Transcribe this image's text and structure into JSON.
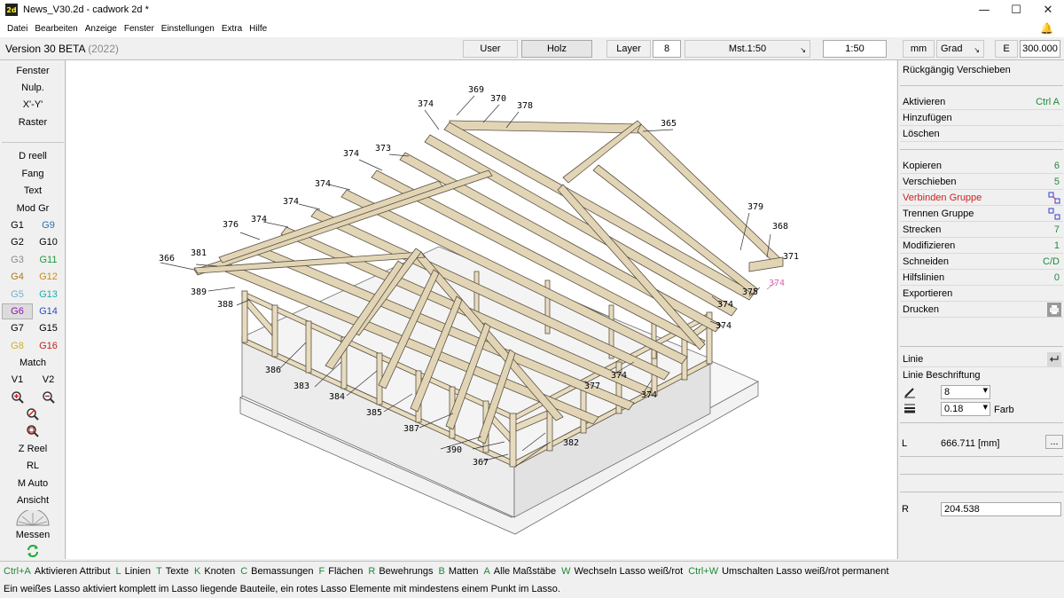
{
  "window": {
    "title": "News_V30.2d - cadwork 2d  *",
    "icon_text": "2d",
    "minimize": "—",
    "maximize": "☐",
    "close": "✕"
  },
  "menu": [
    "Datei",
    "Bearbeiten",
    "Anzeige",
    "Fenster",
    "Einstellungen",
    "Extra",
    "Hilfe"
  ],
  "toolbar": {
    "version": "Version 30 BETA",
    "year": "(2022)",
    "user": "User",
    "holz": "Holz",
    "layer": "Layer",
    "layer_value": "8",
    "scale": "Mst.1:50",
    "scale_value": "1:50",
    "unit": "mm",
    "angle": "Grad",
    "e_label": "E",
    "e_value": "300.000",
    "corner_glyph": "↘"
  },
  "left_panel": {
    "fenster": "Fenster",
    "nulp": "Nulp.",
    "xy": "X'-Y'",
    "raster": "Raster",
    "dreell": "D reell",
    "fang": "Fang",
    "text": "Text",
    "modgr": "Mod Gr",
    "groups": [
      {
        "l": "G1",
        "lc": "#000000",
        "r": "G9",
        "rc": "#2b6fb6"
      },
      {
        "l": "G2",
        "lc": "#000000",
        "r": "G10",
        "rc": "#000000"
      },
      {
        "l": "G3",
        "lc": "#8a8a8a",
        "r": "G11",
        "rc": "#1d9a3a"
      },
      {
        "l": "G4",
        "lc": "#b07a10",
        "r": "G12",
        "rc": "#d08a10"
      },
      {
        "l": "G5",
        "lc": "#70b0d0",
        "r": "G13",
        "rc": "#18b0b0"
      },
      {
        "l": "G6",
        "lc": "#8a1ab0",
        "r": "G14",
        "rc": "#2b4fb6"
      },
      {
        "l": "G7",
        "lc": "#000000",
        "r": "G15",
        "rc": "#000000"
      },
      {
        "l": "G8",
        "lc": "#d0b020",
        "r": "G16",
        "rc": "#c02020"
      }
    ],
    "match": "Match",
    "v1": "V1",
    "v2": "V2",
    "zreel": "Z Reel",
    "rl": "RL",
    "mauto": "M Auto",
    "ansicht": "Ansicht",
    "messen": "Messen"
  },
  "right_panel": {
    "undo": "Rückgängig Verschieben",
    "items": [
      {
        "label": "Aktivieren",
        "key": "Ctrl A"
      },
      {
        "label": "Hinzufügen",
        "key": ""
      },
      {
        "label": "Löschen",
        "key": ""
      }
    ],
    "items2": [
      {
        "label": "Kopieren",
        "key": "6"
      },
      {
        "label": "Verschieben",
        "key": "5"
      },
      {
        "label": "Verbinden Gruppe",
        "key": ""
      },
      {
        "label": "Trennen Gruppe",
        "key": ""
      },
      {
        "label": "Strecken",
        "key": "7"
      },
      {
        "label": "Modifizieren",
        "key": "1"
      },
      {
        "label": "Schneiden",
        "key": "C/D"
      },
      {
        "label": "Hilfslinien",
        "key": "0"
      },
      {
        "label": "Exportieren",
        "key": ""
      },
      {
        "label": "Drucken",
        "key": ""
      }
    ],
    "linie": "Linie",
    "linie_beschriftung": "Linie Beschriftung",
    "pen_value": "8",
    "width_value": "0.18",
    "farb": "Farb",
    "l_label": "L",
    "l_value": "666.711 [mm]",
    "dots": "...",
    "r_label": "R",
    "r_value": "204.538"
  },
  "statusbar": [
    {
      "k": "Ctrl+A",
      "t": "Aktivieren Attribut"
    },
    {
      "k": "L",
      "t": "Linien"
    },
    {
      "k": "T",
      "t": "Texte"
    },
    {
      "k": "K",
      "t": "Knoten"
    },
    {
      "k": "C",
      "t": "Bemassungen"
    },
    {
      "k": "F",
      "t": "Flächen"
    },
    {
      "k": "R",
      "t": "Bewehrungs"
    },
    {
      "k": "B",
      "t": "Matten"
    },
    {
      "k": "A",
      "t": "Alle Maßstäbe"
    },
    {
      "k": "W",
      "t": "Wechseln Lasso weiß/rot"
    },
    {
      "k": "Ctrl+W",
      "t": "Umschalten Lasso weiß/rot permanent"
    }
  ],
  "info": "Ein weißes Lasso aktiviert komplett im Lasso liegende Bauteile, ein rotes Lasso Elemente mit mindestens einem Punkt im Lasso.",
  "drawing_labels": [
    "369",
    "370",
    "378",
    "374",
    "365",
    "373",
    "374",
    "374",
    "374",
    "379",
    "368",
    "376",
    "374",
    "371",
    "366",
    "381",
    "375",
    "374",
    "389",
    "374",
    "388",
    "374",
    "386",
    "383",
    "384",
    "374",
    "385",
    "377",
    "374",
    "387",
    "390",
    "382",
    "367"
  ]
}
